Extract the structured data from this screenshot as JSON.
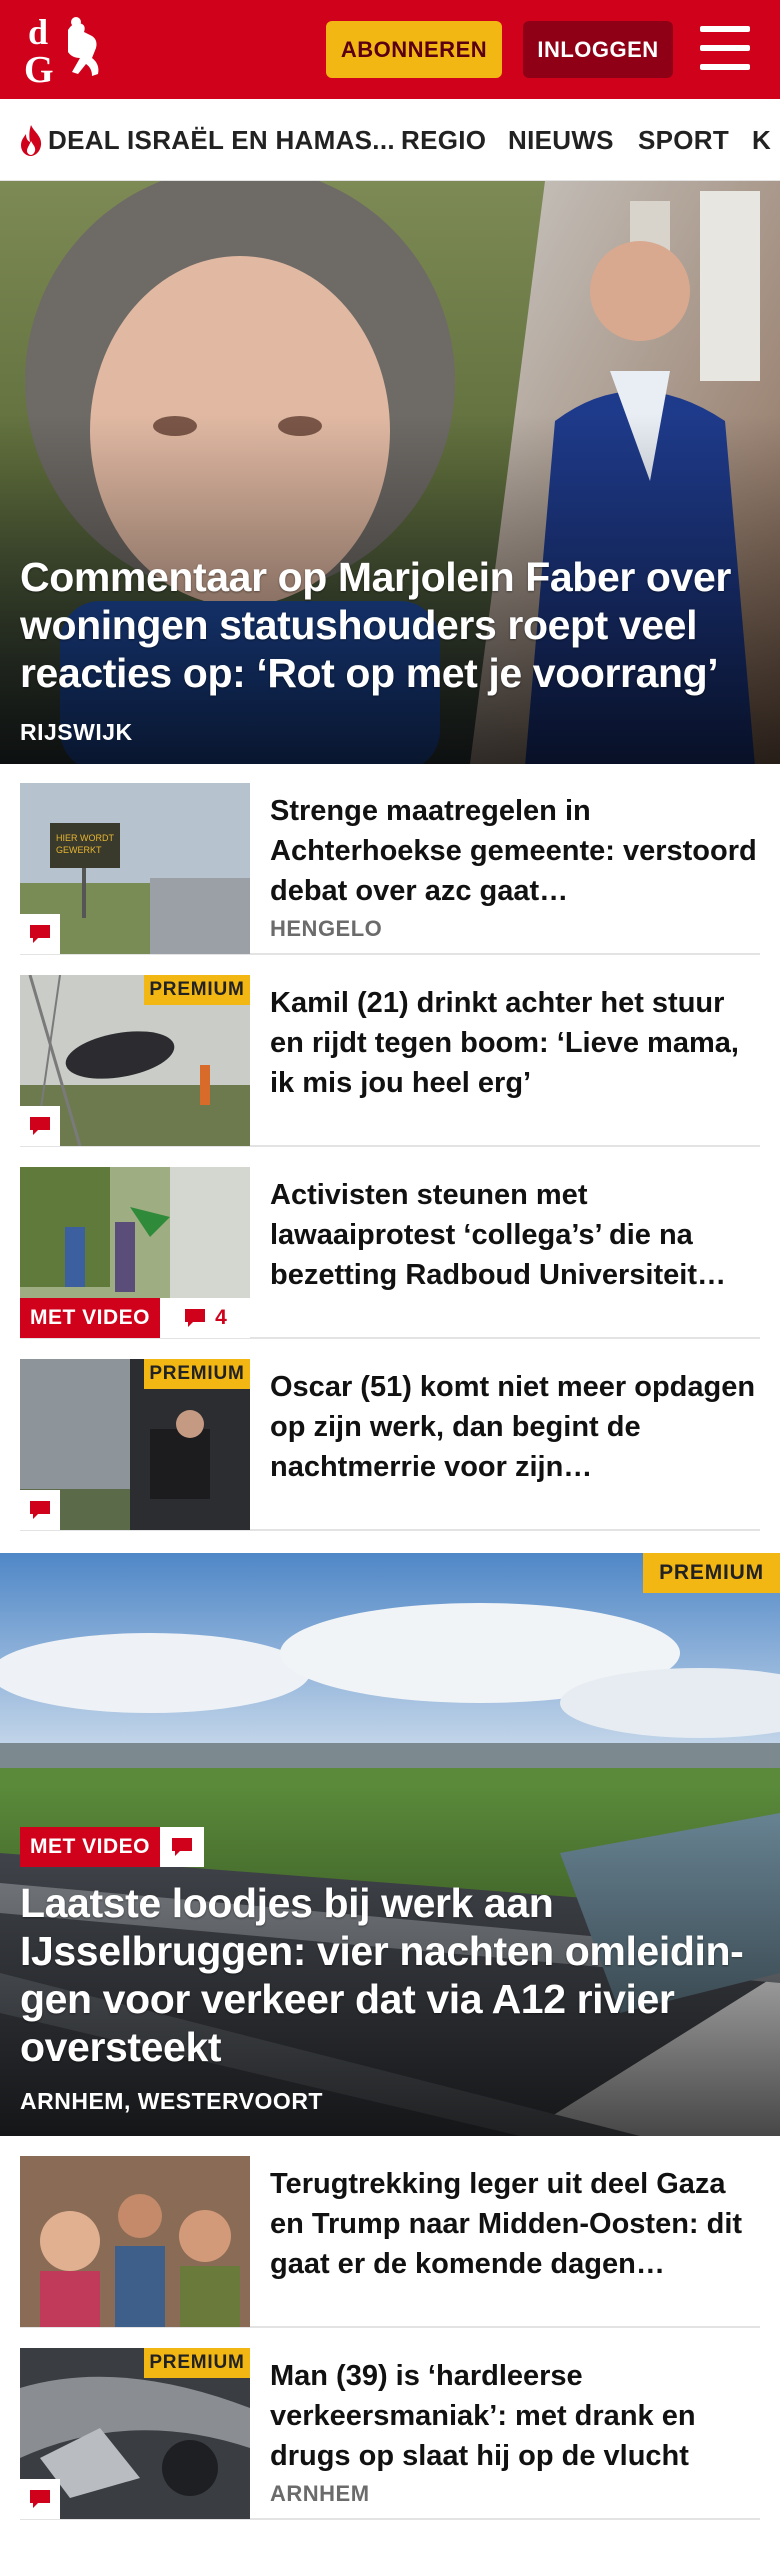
{
  "header": {
    "logo_text": "dG",
    "subscribe_label": "ABONNEREN",
    "login_label": "INLOGGEN"
  },
  "nav": {
    "items": [
      "DEAL ISRAËL EN HAMAS...",
      "REGIO",
      "NIEUWS",
      "SPORT",
      "K"
    ]
  },
  "hero1": {
    "title": "Commentaar op Marjolein Faber over woningen statushouders roept veel reacties op: ‘Rot op met je voorrang’",
    "location": "RIJSWIJK"
  },
  "articles_a": [
    {
      "title": "Strenge maatregelen in Achterhoekse gemeente: verstoord debat over azc gaat…",
      "location": "HENGELO",
      "premium": false,
      "video": false,
      "comments": ""
    },
    {
      "title": "Kamil (21) drinkt achter het stuur en rijdt tegen boom: ‘Lieve mama, ik mis jou heel erg’",
      "location": "",
      "premium": true,
      "video": false,
      "comments": ""
    },
    {
      "title": "Activisten steunen met lawaaiprotest ‘collega’s’ die na bezetting Radboud Universiteit…",
      "location": "",
      "premium": false,
      "video": true,
      "comments": "4"
    },
    {
      "title": "Oscar (51) komt niet meer opdagen op zijn werk, dan begint de nachtmerrie voor zijn…",
      "location": "",
      "premium": true,
      "video": false,
      "comments": ""
    }
  ],
  "hero2": {
    "premium_label": "PREMIUM",
    "video_label": "MET VIDEO",
    "title": "Laatste loodjes bij werk aan IJsselbruggen: vier nachten omleidin-gen voor verkeer dat via A12 rivier oversteekt",
    "location": "ARNHEM, WESTERVOORT"
  },
  "articles_b": [
    {
      "title": "Terugtrekking leger uit deel Gaza en Trump naar Midden-Oosten: dit gaat er de komende dagen…",
      "location": "",
      "premium": false
    },
    {
      "title": "Man (39) is ‘hardleerse verkeersmaniak’: met drank en drugs op slaat hij op de vlucht",
      "location": "ARNHEM",
      "premium": true
    }
  ],
  "labels": {
    "premium": "PREMIUM",
    "video": "MET VIDEO"
  },
  "colors": {
    "brand_red": "#d0021b",
    "dark_red": "#8f0016",
    "premium_yellow": "#f2b713"
  }
}
